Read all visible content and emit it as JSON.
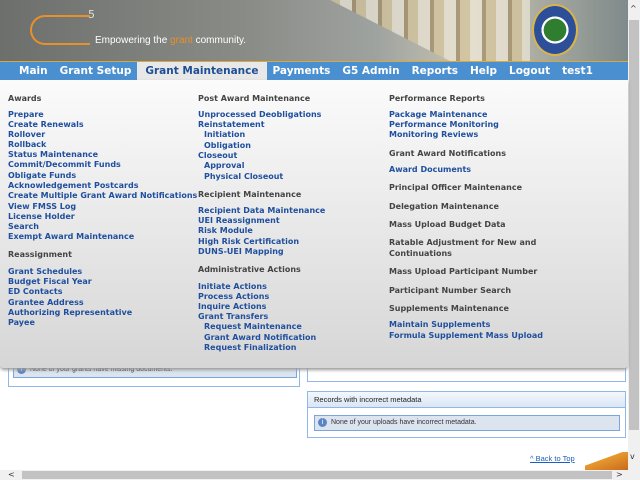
{
  "header": {
    "logo": "G5",
    "tagline_pre": "Empowering the ",
    "tagline_hl": "grant",
    "tagline_post": " community.",
    "seal": "Department of Education"
  },
  "nav": {
    "items": [
      "Main",
      "Grant Setup",
      "Grant Maintenance",
      "Payments",
      "G5 Admin",
      "Reports",
      "Help",
      "Logout",
      "test1"
    ],
    "active": "Grant Maintenance"
  },
  "menu": {
    "awards": {
      "title": "Awards",
      "items": [
        "Prepare",
        "Create Renewals",
        "Rollover",
        "Rollback",
        "Status Maintenance",
        "Commit/Decommit Funds",
        "Obligate Funds",
        "Acknowledgement Postcards",
        "Create Multiple Grant Award Notifications",
        "View FMSS Log",
        "License Holder",
        "Search",
        "Exempt Award Maintenance"
      ]
    },
    "reassignment": {
      "title": "Reassignment",
      "items": [
        "Grant Schedules",
        "Budget Fiscal Year",
        "ED Contacts",
        "Grantee Address",
        "Authorizing Representative",
        "Payee"
      ]
    },
    "post_award": {
      "title": "Post Award Maintenance",
      "items": [
        "Unprocessed Deobligations",
        "Reinstatement",
        "Initiation",
        "Obligation",
        "Closeout",
        "Approval",
        "Physical Closeout"
      ]
    },
    "recipient": {
      "title": "Recipient Maintenance",
      "items": [
        "Recipient Data Maintenance",
        "UEI Reassignment",
        "Risk Module",
        "High Risk Certification",
        "DUNS-UEI Mapping"
      ]
    },
    "admin": {
      "title": "Administrative Actions",
      "items": [
        "Initiate Actions",
        "Process Actions",
        "Inquire Actions",
        "Grant Transfers",
        "Request Maintenance",
        "Grant Award Notification",
        "Request Finalization"
      ]
    },
    "performance": {
      "title": "Performance Reports",
      "items": [
        "Package Maintenance",
        "Performance Monitoring",
        "Monitoring Reviews"
      ]
    },
    "gan": {
      "title": "Grant Award Notifications",
      "items": [
        "Award Documents"
      ]
    },
    "principal": "Principal Officer Maintenance",
    "delegation": "Delegation Maintenance",
    "mass_budget": "Mass Upload Budget Data",
    "ratable_1": "Ratable Adjustment for New and",
    "ratable_2": "Continuations",
    "mass_participant": "Mass Upload Participant Number",
    "participant_search": "Participant Number Search",
    "supplements": {
      "title": "Supplements Maintenance",
      "items": [
        "Maintain Supplements",
        "Formula Supplement Mass Upload"
      ]
    }
  },
  "content": {
    "missing_docs_msg": "None of your grants have missing documents.",
    "metadata_title": "Records with incorrect metadata",
    "metadata_msg": "None of your uploads have incorrect metadata.",
    "back_to_top": "^ Back to Top"
  },
  "colors": {
    "nav": "#4a8fd0",
    "link": "#1f4f9e",
    "accent": "#e8902a"
  }
}
